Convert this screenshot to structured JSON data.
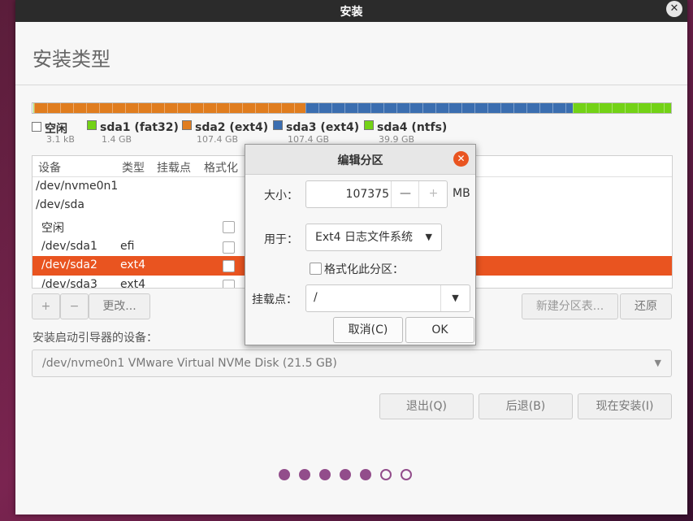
{
  "window": {
    "title": "安装",
    "close_glyph": "✕"
  },
  "page_title": "安装类型",
  "legend": [
    {
      "name": "空闲",
      "size": "3.1 kB",
      "color": "#ffffff"
    },
    {
      "name": "sda1 (fat32)",
      "size": "1.4 GB",
      "color": "#73d216"
    },
    {
      "name": "sda2 (ext4)",
      "size": "107.4 GB",
      "color": "#e07d1f"
    },
    {
      "name": "sda3 (ext4)",
      "size": "107.4 GB",
      "color": "#3b6eb0"
    },
    {
      "name": "sda4 (ntfs)",
      "size": "39.9 GB",
      "color": "#73d216"
    }
  ],
  "table": {
    "headers": [
      "设备",
      "类型",
      "挂载点",
      "格式化"
    ],
    "rows": [
      {
        "device": "/dev/nvme0n1",
        "type": "",
        "selected": false
      },
      {
        "device": "/dev/sda",
        "type": "",
        "selected": false
      },
      {
        "device": "空闲",
        "type": "",
        "selected": false
      },
      {
        "device": "/dev/sda1",
        "type": "efi",
        "selected": false
      },
      {
        "device": "/dev/sda2",
        "type": "ext4",
        "selected": true
      },
      {
        "device": "/dev/sda3",
        "type": "ext4",
        "selected": false
      }
    ]
  },
  "toolbar": {
    "add": "+",
    "remove": "−",
    "change": "更改...",
    "new_table": "新建分区表...",
    "revert": "还原"
  },
  "boot": {
    "label": "安装启动引导器的设备：",
    "value": "/dev/nvme0n1 VMware Virtual NVMe Disk (21.5 GB)"
  },
  "nav": {
    "quit": "退出(Q)",
    "back": "后退(B)",
    "install": "现在安装(I)"
  },
  "progress": {
    "total": 7,
    "filled": 5
  },
  "dialog": {
    "title": "编辑分区",
    "size_label": "大小：",
    "size_value": "107375",
    "size_unit": "MB",
    "use_label": "用于：",
    "use_value": "Ext4 日志文件系统",
    "format_label": "格式化此分区：",
    "mount_label": "挂载点：",
    "mount_value": "/",
    "cancel": "取消(C)",
    "ok": "OK"
  },
  "colors": {
    "accent": "#e95420",
    "progress": "#924d8b"
  }
}
